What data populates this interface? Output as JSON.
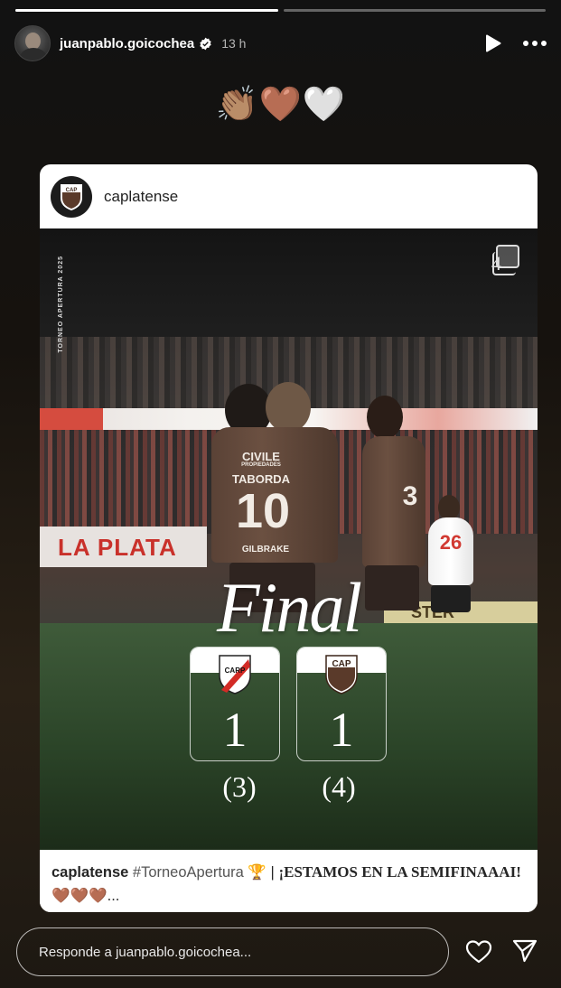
{
  "story": {
    "progress": [
      {
        "index": 1,
        "fill_percent": 100
      },
      {
        "index": 2,
        "fill_percent": 0
      }
    ]
  },
  "header": {
    "username": "juanpablo.goicochea",
    "time": "13 h",
    "verified": true
  },
  "emojis": [
    "👏🏽",
    "🤎",
    "🤍"
  ],
  "post": {
    "username": "caplatense",
    "side_text": "TORNEO APERTURA 2025",
    "multi_count": "4",
    "jersey_name": "TABORDA",
    "jersey_number": "10",
    "jersey_sponsor": "CIVILE",
    "jersey_sponsor_sub": "PROPIEDADES",
    "jersey_brand": "GILBRAKE",
    "player2_number": "3",
    "player3_number": "26",
    "board_text": "LA PLATA",
    "board2_text": "STER",
    "match": {
      "label": "Final",
      "home_badge": "river-plate-crest",
      "away_badge": "CAP",
      "home_score": "1",
      "away_score": "1",
      "home_penalties": "(3)",
      "away_penalties": "(4)"
    },
    "caption": {
      "user": "caplatense",
      "hashtag": "#TorneoApertura",
      "trophy": "🏆",
      "separator": "|",
      "text": "¡ESTAMOS EN LA SEMIFINAAAI!",
      "hearts": "🤎🤎🤎",
      "ellipsis": "..."
    }
  },
  "reply": {
    "placeholder": "Responde a juanpablo.goicochea..."
  },
  "colors": {
    "background": "#16120e",
    "brown": "#5a4236",
    "river_red": "#d54c3f"
  }
}
